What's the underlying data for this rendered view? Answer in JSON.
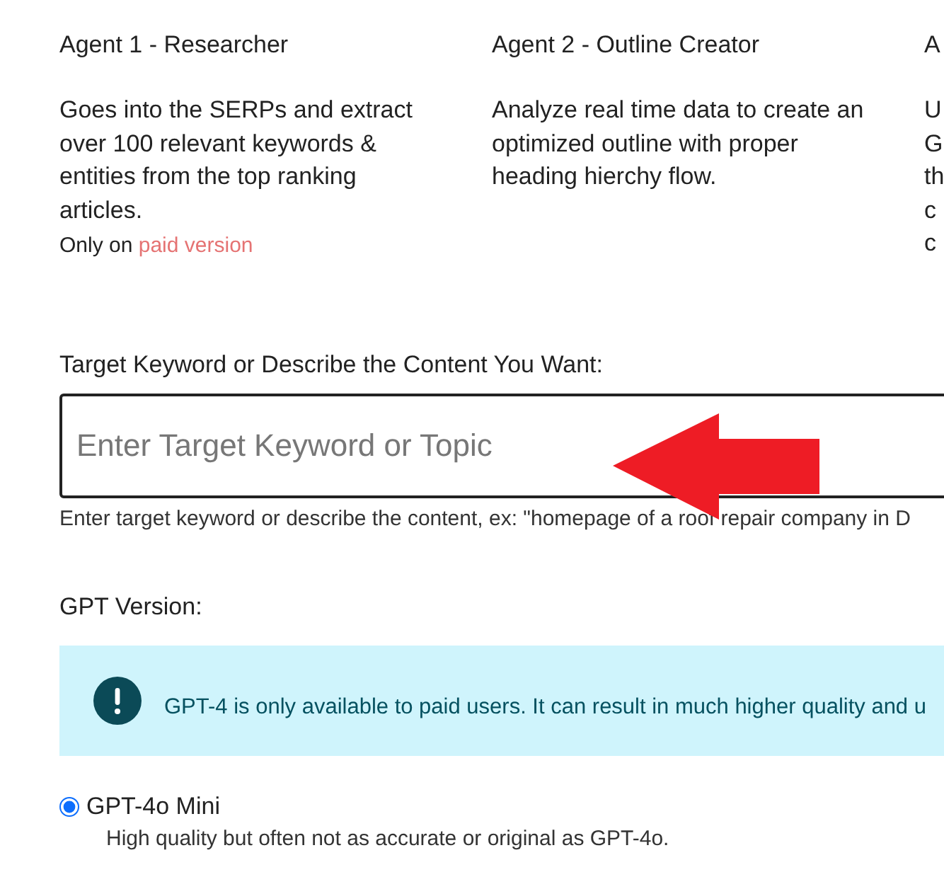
{
  "agents": [
    {
      "title": "Agent 1 - Researcher",
      "lines": [
        "Goes into the SERPs and extract",
        "over 100 relevant keywords &",
        "entities from the top ranking",
        "articles."
      ],
      "note": {
        "prefix": "Only on",
        "link": "paid version"
      }
    },
    {
      "title": "Agent 2 - Outline Creator",
      "lines": [
        "Analyze real time data to create an",
        "optimized outline with proper",
        "heading hierchy flow."
      ]
    },
    {
      "title": "A",
      "lines": [
        "U",
        "G",
        "th",
        "c",
        "c"
      ]
    }
  ],
  "keyword": {
    "label": "Target Keyword or Describe the Content You Want:",
    "placeholder": "Enter Target Keyword or Topic",
    "help": "Enter target keyword or describe the content, ex: \"homepage of a roof repair company in D"
  },
  "gpt": {
    "label": "GPT Version:",
    "alert": "GPT-4 is only available to paid users. It can result in much higher quality and u",
    "options": [
      {
        "label": "GPT-4o Mini",
        "description": "High quality but often not as accurate or original as GPT-4o.",
        "selected": true
      }
    ]
  }
}
